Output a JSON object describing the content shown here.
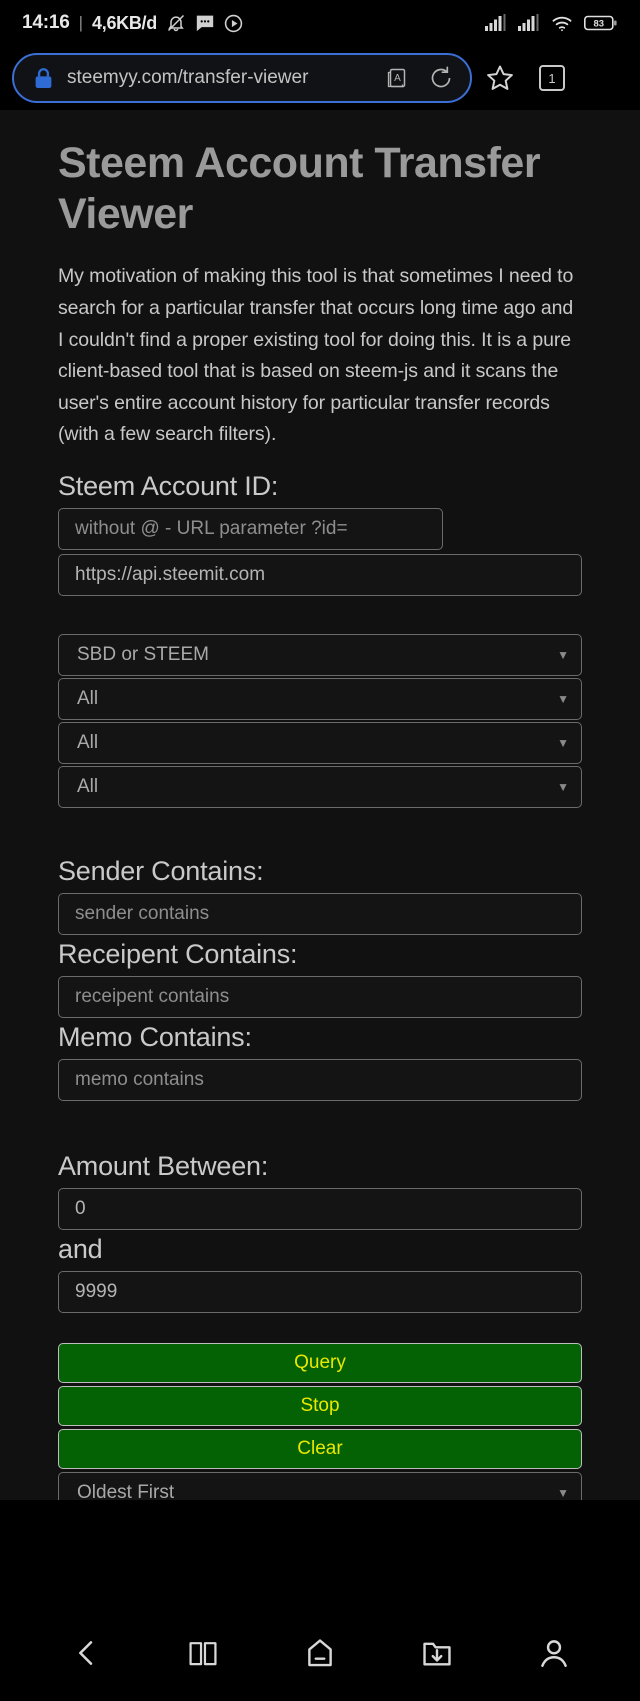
{
  "status_bar": {
    "clock": "14:16",
    "separator": "|",
    "data_rate": "4,6KB/d",
    "icons": [
      "bell-muted-icon",
      "message-icon",
      "media-play-icon",
      "signal-bars-sim1-icon",
      "signal-bars-sim2-icon",
      "wifi-icon",
      "battery-icon"
    ],
    "battery_percent": "83"
  },
  "browser": {
    "url": "steemyy.com/transfer-viewer",
    "lock_icon": "lock-icon",
    "reader_mode_icon": "reader-mode-icon",
    "reload_icon": "reload-icon",
    "bookmark_icon": "star-icon",
    "tab_count": "1"
  },
  "page": {
    "title": "Steem Account Transfer Viewer",
    "intro": "My motivation of making this tool is that sometimes I need to search for a particular transfer that occurs long time ago and I couldn't find a proper existing tool for doing this. It is a pure client-based tool that is based on steem-js and it scans the user's entire account history for particular transfer records (with a few search filters).",
    "account_section_label": "Steem Account ID:",
    "account_id_placeholder": "without @ - URL parameter ?id=",
    "api_node_value": "https://api.steemit.com",
    "filters": {
      "currency": {
        "value": "SBD or STEEM",
        "caret": "▼"
      },
      "filter_two": {
        "value": "All",
        "caret": "▼"
      },
      "filter_three": {
        "value": "All",
        "caret": "▼"
      },
      "filter_four": {
        "value": "All",
        "caret": "▼"
      }
    },
    "sender_label": "Sender Contains:",
    "sender_placeholder": "sender contains",
    "receipent_label": "Receipent Contains:",
    "receipent_placeholder": "receipent contains",
    "memo_label": "Memo Contains:",
    "memo_placeholder": "memo contains",
    "amount_label": "Amount Between:",
    "amount_min": "0",
    "amount_and_label": "and",
    "amount_max": "9999",
    "buttons": {
      "query": "Query",
      "stop": "Stop",
      "clear": "Clear"
    },
    "sort_order": {
      "value": "Oldest First",
      "caret": "▼"
    },
    "results_header": ""
  },
  "bottom_nav": {
    "items": [
      {
        "name": "back-icon"
      },
      {
        "name": "bookmarks-icon"
      },
      {
        "name": "home-icon"
      },
      {
        "name": "downloads-icon"
      },
      {
        "name": "profile-icon"
      }
    ]
  },
  "colors": {
    "accent_url_border": "#3b6fd4",
    "button_green": "#046104",
    "button_text_yellow": "#e8e800",
    "page_background": "#111111"
  }
}
